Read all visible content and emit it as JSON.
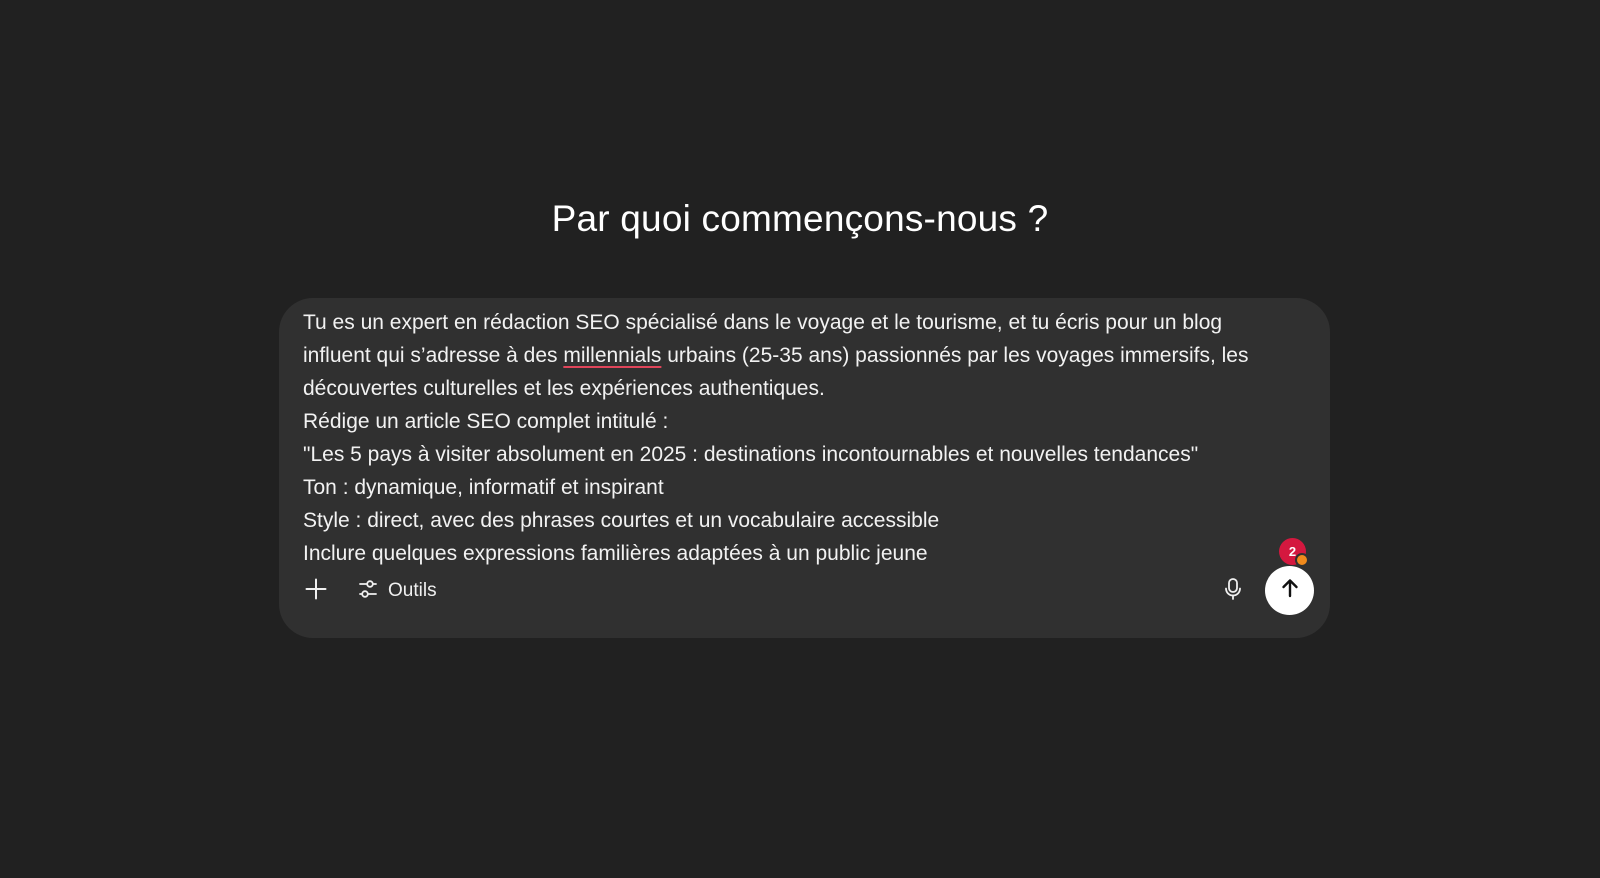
{
  "heading": "Par quoi commençons-nous ?",
  "composer": {
    "lines": [
      {
        "before": "Tu es un expert en rédaction SEO spécialisé dans le voyage et le tourisme, et tu écris pour un blog",
        "flagged": "",
        "after": ""
      },
      {
        "before": "influent qui s’adresse à des ",
        "flagged": "millennials",
        "after": " urbains (25-35 ans) passionnés par les voyages immersifs, les"
      },
      {
        "before": "découvertes culturelles et les expériences authentiques.",
        "flagged": "",
        "after": ""
      },
      {
        "before": "Rédige un article SEO complet intitulé :",
        "flagged": "",
        "after": ""
      },
      {
        "before": "\"Les 5 pays à visiter absolument en 2025 : destinations incontournables et nouvelles tendances\"",
        "flagged": "",
        "after": ""
      },
      {
        "before": "Ton : dynamique, informatif et inspirant",
        "flagged": "",
        "after": ""
      },
      {
        "before": "Style : direct, avec des phrases courtes et un vocabulaire accessible",
        "flagged": "",
        "after": ""
      },
      {
        "before": "Inclure quelques expressions familières adaptées à un public jeune",
        "flagged": "",
        "after": ""
      }
    ],
    "badge_count": "2"
  },
  "toolbar": {
    "add_icon": "plus-icon",
    "tools_icon": "sliders-icon",
    "tools_label": "Outils",
    "mic_icon": "microphone-icon",
    "send_icon": "arrow-up-icon"
  },
  "colors": {
    "background": "#212121",
    "composer": "#303030",
    "badge": "#d4183f",
    "badge_dot": "#f08a1c",
    "spellcheck_underline": "#e0455a"
  }
}
